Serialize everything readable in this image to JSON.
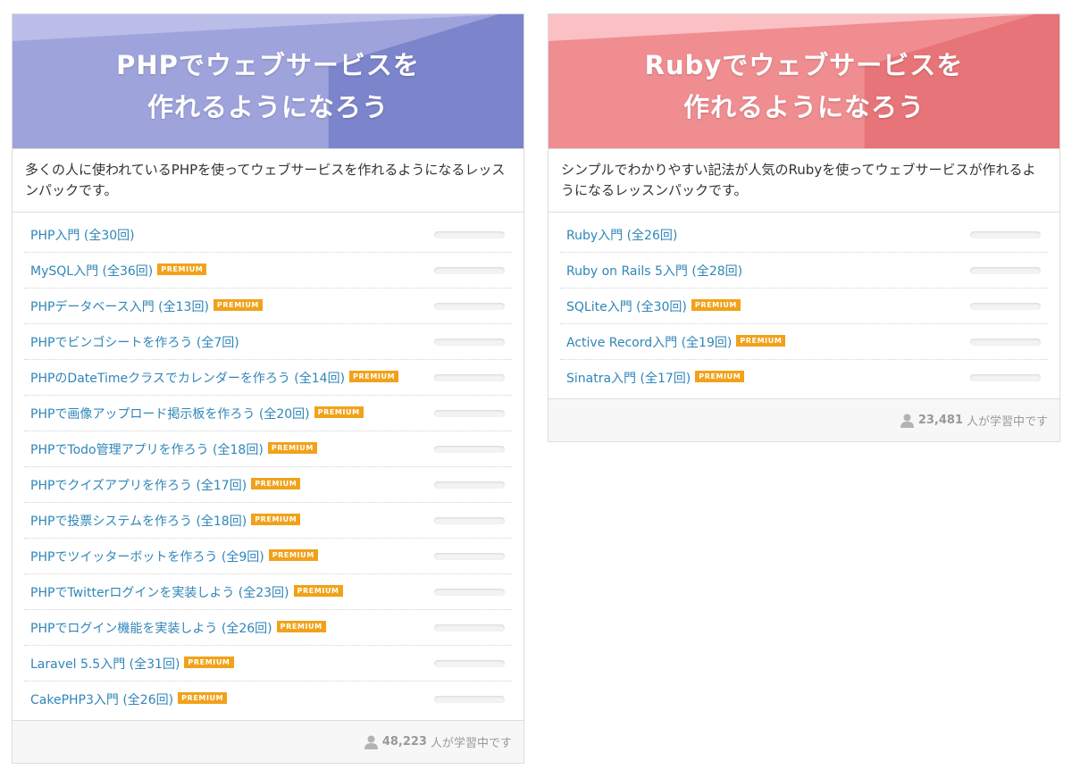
{
  "colors": {
    "php_light": "#b9bde8",
    "php_mid": "#9ea3dc",
    "php_dark": "#7c84cb",
    "ruby_light": "#fbc0c3",
    "ruby_mid": "#ef8d91",
    "ruby_dark": "#e67478",
    "link": "#2f86b8",
    "premium": "#f1a21a"
  },
  "cards": [
    {
      "title_line1": "PHPでウェブサービスを",
      "title_line2": "作れるようになろう",
      "description": "多くの人に使われているPHPを使ってウェブサービスを作れるようになるレッスンパックです。",
      "lessons": [
        {
          "title": "PHP入門 (全30回)",
          "premium": "",
          "progress": 0
        },
        {
          "title": "MySQL入門 (全36回)",
          "premium": "PREMIUM",
          "progress": 0
        },
        {
          "title": "PHPデータベース入門 (全13回)",
          "premium": "PREMIUM",
          "progress": 0
        },
        {
          "title": "PHPでビンゴシートを作ろう (全7回)",
          "premium": "",
          "progress": 0
        },
        {
          "title": "PHPのDateTimeクラスでカレンダーを作ろう (全14回)",
          "premium": "PREMIUM",
          "progress": 0
        },
        {
          "title": "PHPで画像アップロード掲示板を作ろう (全20回)",
          "premium": "PREMIUM",
          "progress": 0
        },
        {
          "title": "PHPでTodo管理アプリを作ろう (全18回)",
          "premium": "PREMIUM",
          "progress": 0
        },
        {
          "title": "PHPでクイズアプリを作ろう (全17回)",
          "premium": "PREMIUM",
          "progress": 0
        },
        {
          "title": "PHPで投票システムを作ろう (全18回)",
          "premium": "PREMIUM",
          "progress": 0
        },
        {
          "title": "PHPでツイッターボットを作ろう (全9回)",
          "premium": "PREMIUM",
          "progress": 0
        },
        {
          "title": "PHPでTwitterログインを実装しよう (全23回)",
          "premium": "PREMIUM",
          "progress": 0
        },
        {
          "title": "PHPでログイン機能を実装しよう (全26回)",
          "premium": "PREMIUM",
          "progress": 0
        },
        {
          "title": "Laravel 5.5入門 (全31回)",
          "premium": "PREMIUM",
          "progress": 0
        },
        {
          "title": "CakePHP3入門 (全26回)",
          "premium": "PREMIUM",
          "progress": 0
        }
      ],
      "learner_count": "48,223",
      "learner_suffix": "人が学習中です"
    },
    {
      "title_line1": "Rubyでウェブサービスを",
      "title_line2": "作れるようになろう",
      "description": "シンプルでわかりやすい記法が人気のRubyを使ってウェブサービスが作れるようになるレッスンパックです。",
      "lessons": [
        {
          "title": "Ruby入門 (全26回)",
          "premium": "",
          "progress": 0
        },
        {
          "title": "Ruby on Rails 5入門 (全28回)",
          "premium": "",
          "progress": 0
        },
        {
          "title": "SQLite入門 (全30回)",
          "premium": "PREMIUM",
          "progress": 0
        },
        {
          "title": "Active Record入門 (全19回)",
          "premium": "PREMIUM",
          "progress": 0
        },
        {
          "title": "Sinatra入門 (全17回)",
          "premium": "PREMIUM",
          "progress": 0
        }
      ],
      "learner_count": "23,481",
      "learner_suffix": "人が学習中です"
    }
  ]
}
